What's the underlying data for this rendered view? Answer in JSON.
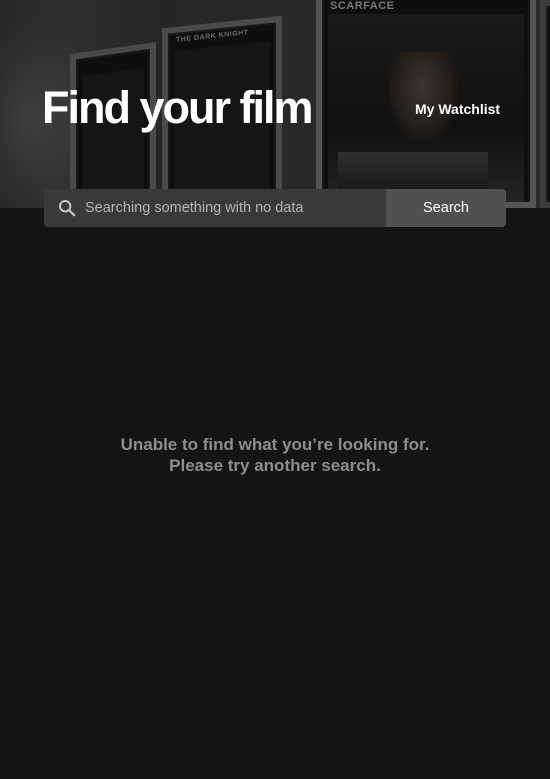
{
  "header": {
    "title": "Find your film",
    "watchlist_label": "My Watchlist"
  },
  "hero": {
    "posters": [
      {
        "caption": ""
      },
      {
        "caption": "THE DARK KNIGHT"
      },
      {
        "caption": "SCARFACE"
      }
    ]
  },
  "search": {
    "value": "Searching something with no data",
    "placeholder": "",
    "button_label": "Search",
    "icon": "search-icon"
  },
  "results": {
    "empty_message": "Unable to find what you’re looking for. Please try another search."
  },
  "colors": {
    "background": "#141414",
    "search_field": "#393939",
    "search_button": "#505050",
    "muted_text": "#8d8d8d"
  }
}
